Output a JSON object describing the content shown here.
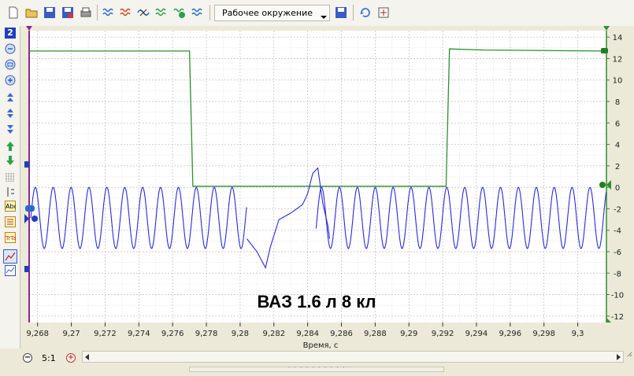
{
  "toolbar": {
    "environment_label": "Рабочее окружение",
    "icons": [
      "new-file-icon",
      "open-folder-icon",
      "save-icon",
      "save-as-icon",
      "print-icon",
      "waveform-icon",
      "waveform-alt-icon",
      "waveform-cross-icon",
      "waveform-check-icon",
      "waveform-number-icon",
      "waveform-plus-icon",
      "save-environment-icon",
      "refresh-icon",
      "fit-window-icon"
    ]
  },
  "left_toolbar": {
    "zoom_badge": "2",
    "icons": [
      "zoom-out-icon",
      "zoom-fit-icon",
      "zoom-in-icon",
      "scroll-up-fast-icon",
      "scroll-updown-icon",
      "scroll-down-fast-icon",
      "arrow-up-green-icon",
      "arrow-down-green-icon",
      "grid-toggle-icon",
      "cursor-toggle-icon",
      "text-label-icon",
      "list-icon",
      "channel-label-icon",
      "chart-view-icon",
      "chart-view-alt-icon"
    ]
  },
  "chart_data": {
    "type": "line",
    "annotation": "ВАЗ 1.6 л 8 кл",
    "xlabel": "Время, с",
    "xlim": [
      9.2675,
      9.3017
    ],
    "x_ticks": [
      "9,268",
      "9,27",
      "9,272",
      "9,274",
      "9,276",
      "9,278",
      "9,28",
      "9,282",
      "9,284",
      "9,286",
      "9,288",
      "9,29",
      "9,292",
      "9,294",
      "9,296",
      "9,298",
      "9,3"
    ],
    "ylim": [
      -12.6,
      14.6
    ],
    "y_ticks": [
      "14",
      "12",
      "10",
      "8",
      "6",
      "4",
      "2",
      "0",
      "-2",
      "-4",
      "-6",
      "-8",
      "-10",
      "-12"
    ],
    "grid": true,
    "series": [
      {
        "color": "#2f8f2f",
        "points": [
          [
            9.2675,
            12.7
          ],
          [
            9.277,
            12.7
          ],
          [
            9.2772,
            0.1
          ],
          [
            9.2922,
            0.1
          ],
          [
            9.2924,
            12.9
          ],
          [
            9.2945,
            12.8
          ],
          [
            9.3017,
            12.7
          ]
        ]
      },
      {
        "color": "#2a2ae0",
        "type": "oscillation",
        "period": 0.00106,
        "amplitude_hi": 0.0,
        "amplitude_lo": -5.7,
        "x_start": 9.2676,
        "gap": [
          9.2804,
          9.2845
        ],
        "gap_points": [
          [
            9.2804,
            -4.8
          ],
          [
            9.281,
            -6.0
          ],
          [
            9.2815,
            -7.5
          ],
          [
            9.2818,
            -5.5
          ],
          [
            9.2823,
            -3.0
          ],
          [
            9.283,
            -2.4
          ],
          [
            9.2837,
            -1.6
          ],
          [
            9.284,
            -0.6
          ],
          [
            9.2843,
            1.3
          ],
          [
            9.2846,
            1.8
          ],
          [
            9.2849,
            -1.5
          ],
          [
            9.2852,
            -3.6
          ],
          [
            9.2853,
            -4.8
          ]
        ]
      }
    ]
  },
  "bottom": {
    "scale_label": "5:1"
  }
}
